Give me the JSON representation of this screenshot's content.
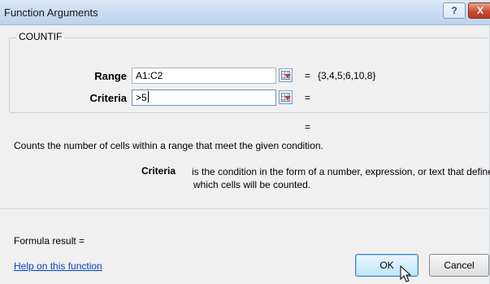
{
  "window": {
    "title": "Function Arguments",
    "help_glyph": "?",
    "close_glyph": "X"
  },
  "function": {
    "name": "COUNTIF",
    "args": [
      {
        "label": "Range",
        "value": "A1:C2",
        "eq": "=",
        "result": "{3,4,5;6,10,8}"
      },
      {
        "label": "Criteria",
        "value": ">5",
        "eq": "=",
        "result": ""
      }
    ],
    "overall_eq": "=",
    "description": "Counts the number of cells within a range that meet the given condition.",
    "arg_help_name": "Criteria",
    "arg_help_text_line1": "is the condition in the form of a number, expression, or text that defines",
    "arg_help_text_line2": "which cells will be counted."
  },
  "footer": {
    "formula_result": "Formula result =",
    "help_link": "Help on this function",
    "ok_label": "OK",
    "cancel_label": "Cancel"
  },
  "icons": {
    "help": "help-icon",
    "close": "close-icon",
    "collapse": "collapse-dialog-icon",
    "cursor": "mouse-pointer-icon"
  },
  "colors": {
    "titlebar": "#c8dbf1",
    "close_button": "#c8472f",
    "link": "#0645c1",
    "ok_button": "#bee6fd"
  }
}
